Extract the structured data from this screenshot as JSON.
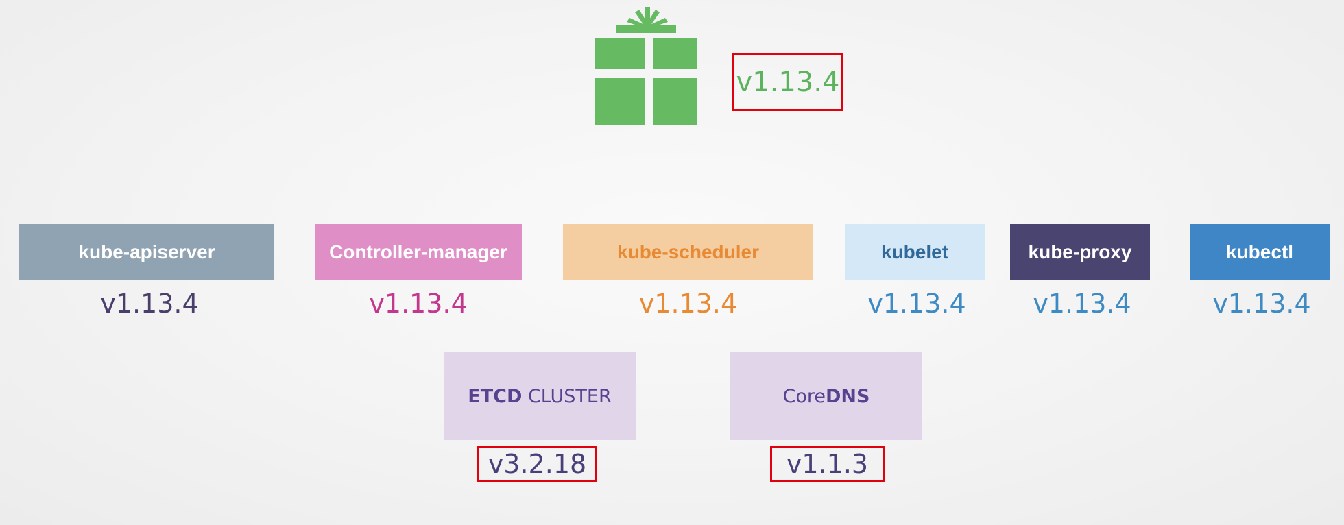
{
  "release": {
    "icon": "gift-icon",
    "version": "v1.13.4"
  },
  "components": [
    {
      "name": "kube-apiserver",
      "version": "v1.13.4",
      "box_color": "#8fa3b3",
      "label_color": "#ffffff",
      "version_color": "#4a3f6b"
    },
    {
      "name": "Controller-manager",
      "version": "v1.13.4",
      "box_color": "#df8fc5",
      "label_color": "#ffffff",
      "version_color": "#c4378f"
    },
    {
      "name": "kube-scheduler",
      "version": "v1.13.4",
      "box_color": "#f4cea0",
      "label_color": "#e88a33",
      "version_color": "#e88a33"
    },
    {
      "name": "kubelet",
      "version": "v1.13.4",
      "box_color": "#d5e8f8",
      "label_color": "#2f6a9a",
      "version_color": "#3e8bc4"
    },
    {
      "name": "kube-proxy",
      "version": "v1.13.4",
      "box_color": "#4a4470",
      "label_color": "#ffffff",
      "version_color": "#3e8bc4"
    },
    {
      "name": "kubectl",
      "version": "v1.13.4",
      "box_color": "#3e86c6",
      "label_color": "#ffffff",
      "version_color": "#3e8bc4"
    }
  ],
  "addons": [
    {
      "name_bold": "ETCD",
      "name_regular": " CLUSTER",
      "version": "v3.2.18"
    },
    {
      "name_regular": "Core",
      "name_bold": "DNS",
      "version": "v1.1.3"
    }
  ],
  "colors": {
    "highlight_border": "#e0000e",
    "gift": "#66bb62",
    "release_version": "#5db35d",
    "addon_box": "#e1d5ea",
    "addon_text": "#56428f"
  }
}
